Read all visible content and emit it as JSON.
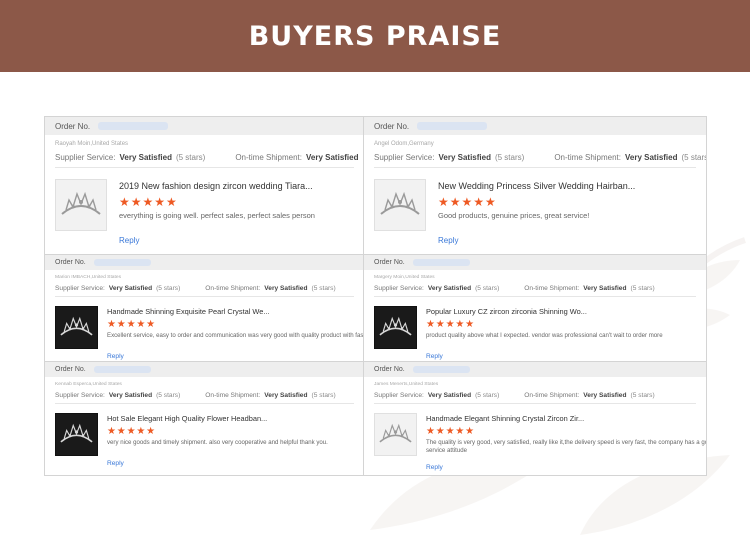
{
  "banner": {
    "title": "BUYERS PRAISE"
  },
  "common": {
    "order_label": "Order No.",
    "supplier_label": "Supplier Service:",
    "shipment_label": "On-time Shipment:",
    "satisfied": "Very Satisfied",
    "stars_note": "(5 stars)",
    "reply": "Reply"
  },
  "reviews": [
    {
      "buyer": "Raoyah Moin,United States",
      "title": "2019 New fashion design zircon wedding Tiara...",
      "rating": "★★★★★",
      "comment": "everything is going well. perfect sales, perfect sales person"
    },
    {
      "buyer": "Angel Odom,Germany",
      "title": "New Wedding Princess Silver Wedding Hairban...",
      "rating": "★★★★★",
      "comment": "Good products, genuine prices, great service!"
    },
    {
      "buyer": "Marion IMBACH,United States",
      "title": "Handmade Shinning Exquisite Pearl Crystal We...",
      "rating": "★★★★★",
      "comment": "Excellent service, easy to order and communication was very good with quality product with fast delivery"
    },
    {
      "buyer": "Margery Moin,United States",
      "title": "Popular Luxury CZ zircon zirconia Shinning Wo...",
      "rating": "★★★★★",
      "comment": "product quality above what I expected.  vendor was professional can't wait to order more"
    },
    {
      "buyer": "Kennab Esperca,United States",
      "title": "Hot Sale Elegant High Quality Flower Headban...",
      "rating": "★★★★★",
      "comment": "very nice goods and timely shipment. also very cooperative and helpful    thank you."
    },
    {
      "buyer": "James Menerts,United States",
      "title": "Handmade Elegant Shinning Crystal Zircon Zir...",
      "rating": "★★★★★",
      "comment": "The quality is very good, very satisfied, really like it,the delivery speed is very fast, the company has a good",
      "comment2": "service attitude"
    }
  ]
}
